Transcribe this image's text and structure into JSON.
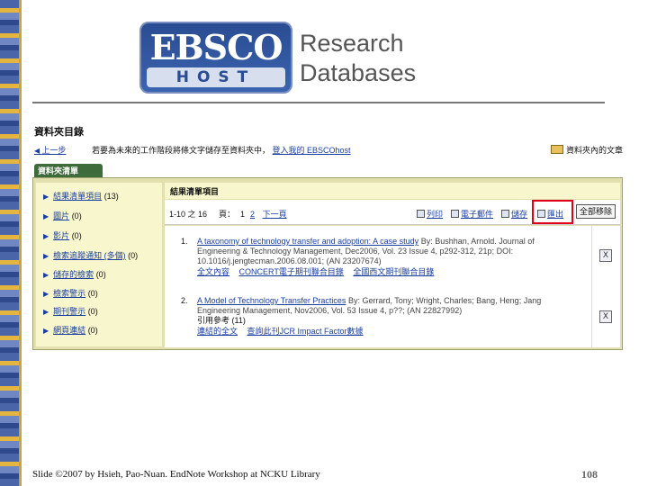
{
  "logo": {
    "top": "EBSCO",
    "bottom": "HOST",
    "line1": "Research",
    "line2": "Databases"
  },
  "page_title": "資料夾目錄",
  "nav": {
    "prev": "上一步",
    "instruction": "若要為未來的工作階段將條文字儲存至資料夾中，",
    "login": "登入我的 EBSCOhost",
    "folder": "資料夾內的文章"
  },
  "tab_label": "資料夾清單",
  "sidebar": {
    "items": [
      {
        "label": "結果清單項目",
        "count": "(13)"
      },
      {
        "label": "圖片",
        "count": "(0)"
      },
      {
        "label": "影片",
        "count": "(0)"
      },
      {
        "label": "檢索追蹤通知 (多個)",
        "count": "(0)"
      },
      {
        "label": "儲存的檢索",
        "count": "(0)"
      },
      {
        "label": "檢索警示",
        "count": "(0)"
      },
      {
        "label": "期刊警示",
        "count": "(0)"
      },
      {
        "label": "網頁連結",
        "count": "(0)"
      }
    ]
  },
  "results": {
    "header": "結果清單項目",
    "range": "1-10 之 16",
    "page_label": "頁：",
    "page_current": "1",
    "page_other": "2",
    "next": "下一頁",
    "tools": {
      "print": "列印",
      "email": "電子郵件",
      "save": "儲存",
      "export": "匯出"
    },
    "clear_all": "全部移除",
    "records": [
      {
        "num": "1.",
        "title": "A taxonomy of technology transfer and adoption: A case study",
        "line1": "By: Bushhan, Arnold. Journal of",
        "line2": "Engineering & Technology Management, Dec2006, Vol. 23 Issue 4, p292-312, 21p; DOI:",
        "line3": "10.1016/j.jengtecman.2006.08.001; (AN 23207674)",
        "links": [
          "全文內容",
          "CONCERT電子期刊聯合目錄",
          "全國西文期刊聯合目錄"
        ],
        "ref": ""
      },
      {
        "num": "2.",
        "title": "A Model of Technology Transfer Practices",
        "line1": "By: Gerrard, Tony; Wright, Charles; Bang, Heng; Jang",
        "line2": "Engineering Management, Nov2006, Vol. 53 Issue 4, p??; (AN 22827992)",
        "line3": "",
        "ref": "引用參考 (11)",
        "links": [
          "連結的全文",
          "查詢此刊JCR Impact Factor數據"
        ]
      }
    ],
    "remove_icon": "X"
  },
  "footer": "Slide ©2007  by Hsieh, Pao-Nuan.  EndNote Workshop at NCKU Library",
  "page_number": "108"
}
